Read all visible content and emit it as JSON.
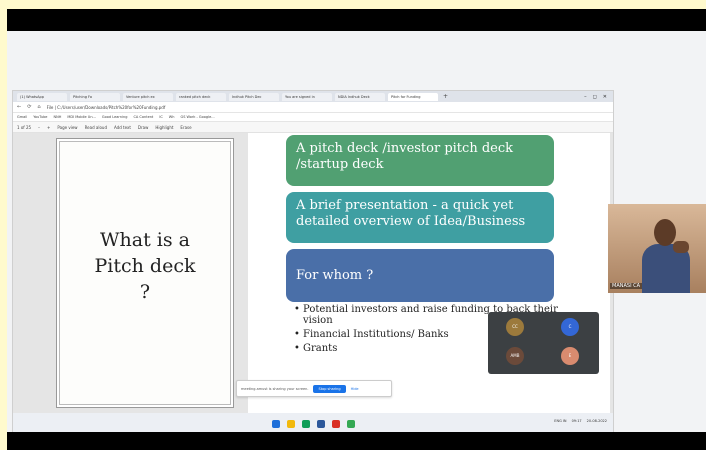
{
  "browser": {
    "tabs": [
      {
        "label": "(1) WhatsApp",
        "active": false
      },
      {
        "label": "Pitching Fo",
        "active": false
      },
      {
        "label": "Venture pitch ex",
        "active": false
      },
      {
        "label": "ranked pitch deck",
        "active": false
      },
      {
        "label": "Indhuk Pitch Dec",
        "active": false
      },
      {
        "label": "You are signed in",
        "active": false
      },
      {
        "label": "NDIA Indhuk Deck",
        "active": false
      },
      {
        "label": "Pitch for Funding",
        "active": true
      }
    ],
    "new_tab": "+",
    "window_controls": [
      "–",
      "◻",
      "✕"
    ],
    "address": "File | C:/Users/user/Downloads/Pitch%20for%20Funding.pdf",
    "bookmarks": [
      "Gmail",
      "YouTube",
      "NNH",
      "MDI Mobile Un...",
      "Good Learning",
      "CA Content",
      "IC",
      "Wh",
      "GS Work - Google..."
    ],
    "pdf_toolbar": [
      "1 of 25",
      "–",
      "+",
      "Page view",
      "Read aloud",
      "Add text",
      "Draw",
      "Highlight",
      "Erase"
    ]
  },
  "slides": {
    "left_title_lines": [
      "What is a",
      "Pitch deck",
      "?"
    ],
    "cards": [
      "A pitch deck /investor pitch deck /startup deck",
      "A brief presentation - a quick yet detailed overview of Idea/Business",
      "For whom ?"
    ],
    "bullets": [
      "Potential investors and raise funding to back their vision",
      "Financial Institutions/ Banks",
      "Grants"
    ]
  },
  "share_bar": {
    "message": "meeting.amust is sharing your screen.",
    "stop_label": "Stop sharing",
    "hide_label": "Hide"
  },
  "participants": [
    {
      "initials": "CC",
      "color": "#9c7a3c"
    },
    {
      "initials": "C",
      "color": "#3367d6"
    },
    {
      "initials": "AMB",
      "color": "#6b4a3a"
    },
    {
      "initials": "E",
      "color": "#d98b6f"
    }
  ],
  "video": {
    "name": "MANASI CA"
  },
  "tray": {
    "lang": "ENG IN",
    "time": "09:17",
    "date": "20-08-2022"
  }
}
